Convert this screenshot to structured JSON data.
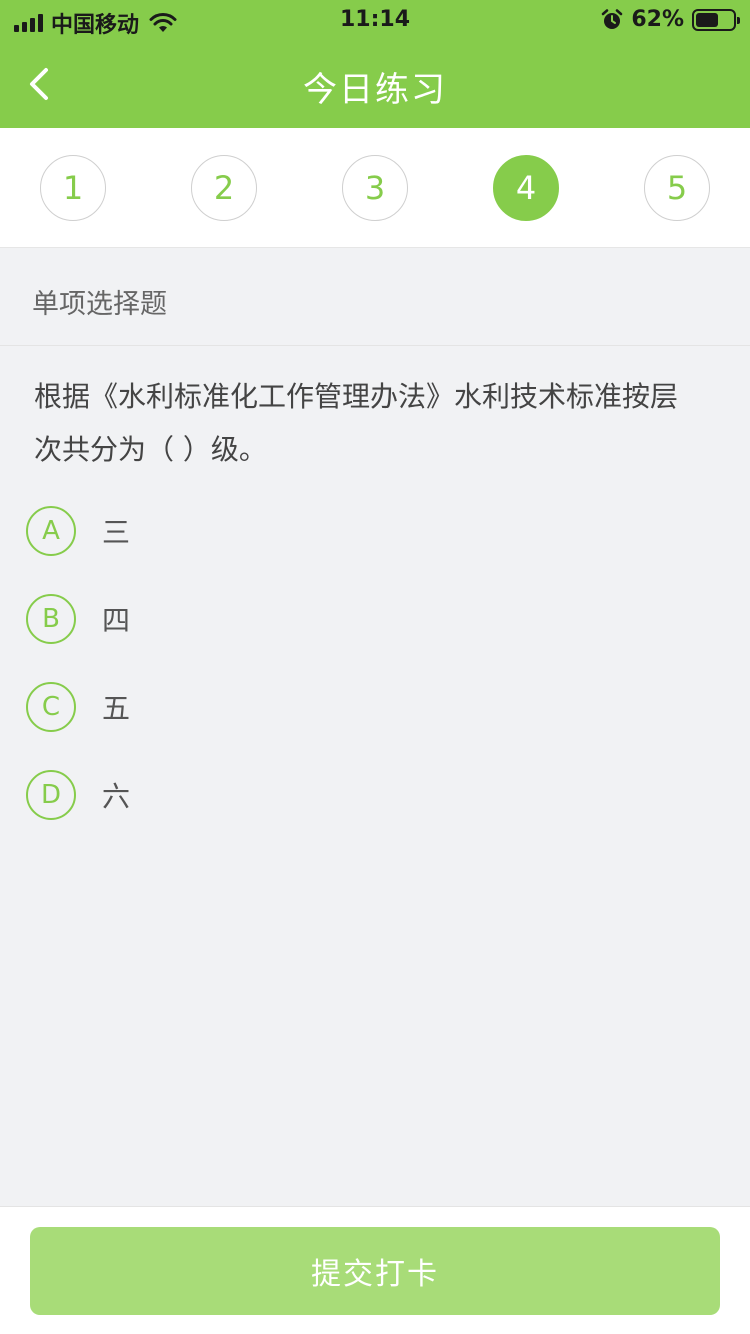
{
  "status_bar": {
    "carrier": "中国移动",
    "time": "11:14",
    "battery_text": "62%",
    "battery_level": 0.62
  },
  "nav": {
    "title": "今日练习",
    "back_icon": "chevron-left-icon"
  },
  "question_numbers": [
    {
      "label": "1",
      "active": false
    },
    {
      "label": "2",
      "active": false
    },
    {
      "label": "3",
      "active": false
    },
    {
      "label": "4",
      "active": true
    },
    {
      "label": "5",
      "active": false
    }
  ],
  "section": {
    "title": "单项选择题"
  },
  "question": {
    "text_line1": "根据《水利标准化工作管理办法》水利技术标准按层",
    "text_line2": "次共分为（    ）级。"
  },
  "options": [
    {
      "letter": "A",
      "text": "三"
    },
    {
      "letter": "B",
      "text": "四"
    },
    {
      "letter": "C",
      "text": "五"
    },
    {
      "letter": "D",
      "text": "六"
    }
  ],
  "footer": {
    "submit_label": "提交打卡"
  },
  "colors": {
    "accent": "#86cc4b",
    "button_disabled": "#a8dc78",
    "background": "#f1f2f4"
  }
}
